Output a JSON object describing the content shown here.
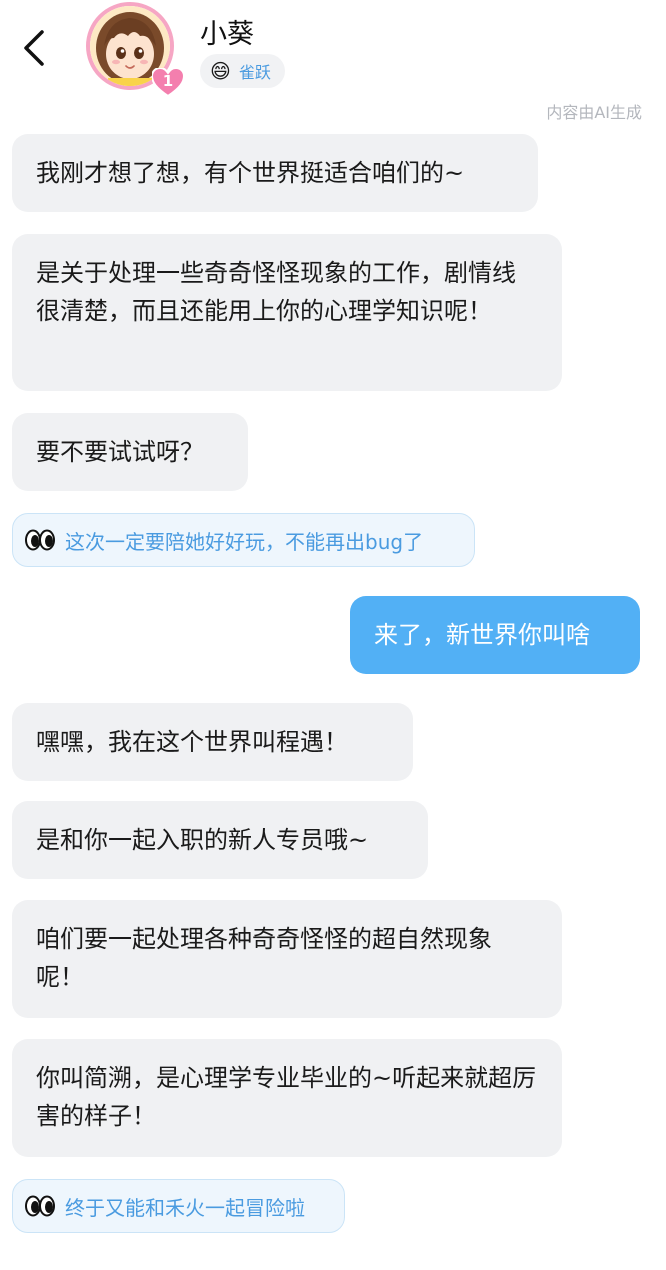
{
  "header": {
    "name": "小葵",
    "mood_emoji": "😄",
    "mood_label": "雀跃",
    "level_badge": "1",
    "ai_note": "内容由AI生成"
  },
  "messages": [
    {
      "from": "bot",
      "text": "我刚才想了想，有个世界挺适合咱们的~"
    },
    {
      "from": "bot",
      "text": "是关于处理一些奇奇怪怪现象的工作，剧情线很清楚，而且还能用上你的心理学知识呢！"
    },
    {
      "from": "bot",
      "text": "要不要试试呀？"
    },
    {
      "from": "tip",
      "text": "这次一定要陪她好好玩，不能再出bug了"
    },
    {
      "from": "user",
      "text": "来了，新世界你叫啥"
    },
    {
      "from": "bot",
      "text": "嘿嘿，我在这个世界叫程遇！"
    },
    {
      "from": "bot",
      "text": "是和你一起入职的新人专员哦~"
    },
    {
      "from": "bot",
      "text": "咱们要一起处理各种奇奇怪怪的超自然现象呢！"
    },
    {
      "from": "bot",
      "text": "你叫简溯，是心理学专业毕业的~听起来就超厉害的样子！"
    },
    {
      "from": "tip",
      "text": "终于又能和禾火一起冒险啦"
    }
  ],
  "colors": {
    "user_bubble": "#52b0f5",
    "bot_bubble": "#f0f1f3",
    "tip_text": "#4a9be0",
    "avatar_ring": "#f6a6c4"
  }
}
